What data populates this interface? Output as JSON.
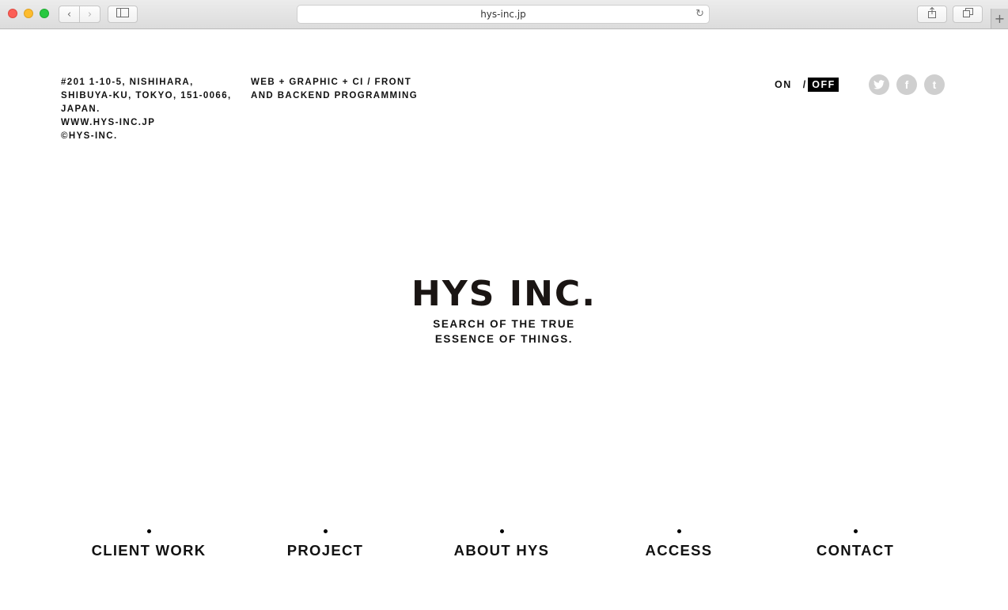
{
  "browser": {
    "url": "hys-inc.jp",
    "back_icon": "chevron-left-icon",
    "forward_icon": "chevron-right-icon",
    "sidebar_icon": "sidebar-icon",
    "share_icon": "share-icon",
    "tabs_icon": "tabs-overview-icon",
    "reload_icon": "reload-icon",
    "newtab_icon": "plus-icon"
  },
  "header": {
    "address_lines": [
      "#201 1-10-5, NISHIHARA,",
      "SHIBUYA-KU, TOKYO, 151-0066,",
      "JAPAN.",
      "WWW.HYS-INC.JP",
      "©HYS-INC."
    ],
    "services_lines": [
      "WEB + GRAPHIC + CI / FRONT",
      "AND BACKEND PROGRAMMING"
    ],
    "toggle": {
      "on": "ON",
      "separator": "/",
      "off": "OFF",
      "selected": "OFF"
    },
    "social": [
      {
        "name": "twitter-icon",
        "glyph": "🐦"
      },
      {
        "name": "facebook-icon",
        "glyph": "f"
      },
      {
        "name": "tumblr-icon",
        "glyph": "t"
      }
    ]
  },
  "hero": {
    "title": "HYS INC.",
    "tagline_lines": [
      "SEARCH OF THE TRUE",
      "ESSENCE OF THINGS."
    ]
  },
  "nav": {
    "items": [
      "CLIENT WORK",
      "PROJECT",
      "ABOUT HYS",
      "ACCESS",
      "CONTACT"
    ]
  },
  "colors": {
    "text": "#111111",
    "off_bg": "#000000",
    "social_gray": "#cfcfcf",
    "traffic_red": "#fc5f57",
    "traffic_yellow": "#fdbc2e",
    "traffic_green": "#28c840"
  }
}
